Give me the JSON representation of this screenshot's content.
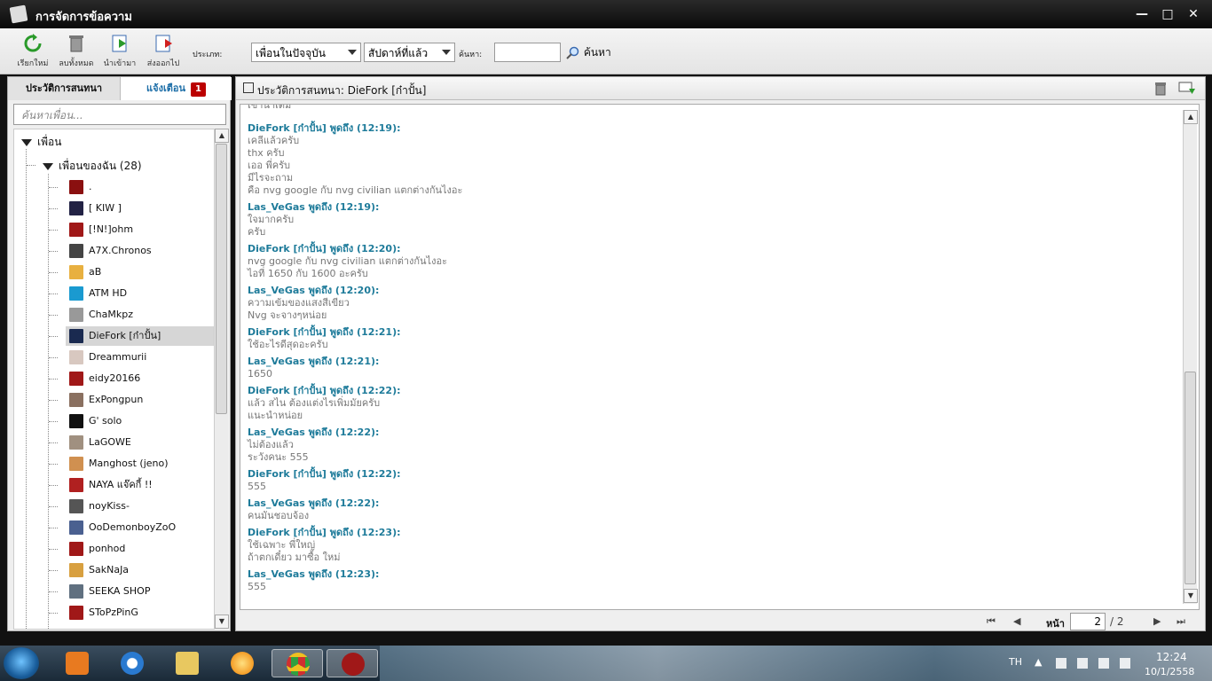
{
  "window": {
    "title": "การจัดการข้อความ",
    "controls": {
      "minimize": "—",
      "maximize": "□",
      "close": "✕"
    }
  },
  "toolbar": {
    "buttons": [
      {
        "label": "เรียกใหม่",
        "icon": "refresh-icon"
      },
      {
        "label": "ลบทั้งหมด",
        "icon": "trash-icon"
      },
      {
        "label": "นำเข้ามา",
        "icon": "import-icon"
      },
      {
        "label": "ส่งออกไป",
        "icon": "export-icon"
      }
    ],
    "type_label": "ประเภท:",
    "type_value": "เพื่อนในปัจจุบัน",
    "period_value": "สัปดาห์ที่แล้ว",
    "search_label": "ค้นหา:",
    "search_value": "",
    "search_button": "ค้นหา"
  },
  "left_panel": {
    "tab_history": "ประวัติการสนทนา",
    "tab_notify": "แจ้งเตือน",
    "notify_count": "1",
    "friend_search_placeholder": "ค้นหาเพื่อน...",
    "root": "เพื่อน",
    "group": "เพื่อนของฉัน (28)",
    "friends": [
      {
        "name": ".",
        "color": "#8a1010"
      },
      {
        "name": "[ KIW ]",
        "color": "#222244"
      },
      {
        "name": "[!N!]ohm",
        "color": "#a01818"
      },
      {
        "name": "A7X.Chronos",
        "color": "#444"
      },
      {
        "name": "aB",
        "color": "#e8b040"
      },
      {
        "name": "ATM HD",
        "color": "#1a9ad0"
      },
      {
        "name": "ChaMkpz",
        "color": "#999"
      },
      {
        "name": "DieFork [ก๋าปั้น]",
        "color": "#1a2a50"
      },
      {
        "name": "Dreammurii",
        "color": "#d8c8c0"
      },
      {
        "name": "eidy20166",
        "color": "#a01818"
      },
      {
        "name": "ExPongpun",
        "color": "#8a7060"
      },
      {
        "name": "G' solo",
        "color": "#111"
      },
      {
        "name": "LaGOWE",
        "color": "#a09080"
      },
      {
        "name": "Manghost (jeno)",
        "color": "#d09050"
      },
      {
        "name": "NAYA แจ๊คกี้ !!",
        "color": "#b02020"
      },
      {
        "name": "noyKiss-",
        "color": "#555"
      },
      {
        "name": "OoDemonboyZoO",
        "color": "#4a6090"
      },
      {
        "name": "ponhod",
        "color": "#a01818"
      },
      {
        "name": "SakNaJa",
        "color": "#d8a040"
      },
      {
        "name": "SEEKA SHOP",
        "color": "#607080"
      },
      {
        "name": "SToPzPinG",
        "color": "#a01818"
      }
    ]
  },
  "conversation": {
    "header": "ประวัติการสนทนา: DieFork [ก๋าปั้น]",
    "partial_top": "เข้าน่าเดิม",
    "messages": [
      {
        "head": "DieFork [ก๋าปั้น] พูดถึง  (12:19):",
        "lines": [
          "เคลีแล้วครับ",
          "thx ครับ",
          "เออ พี่ครับ",
          "มีไรจะถาม",
          "คือ nvg google กับ nvg civilian แตกต่างกันไงอะ"
        ]
      },
      {
        "head": "Las_VeGas พูดถึง  (12:19):",
        "lines": [
          "ใจมากครับ",
          "ครับ"
        ]
      },
      {
        "head": "DieFork [ก๋าปั้น] พูดถึง  (12:20):",
        "lines": [
          "nvg google กับ nvg civilian แตกต่างกันไงอะ",
          "ไอที่ 1650 กับ 1600 อะครับ"
        ]
      },
      {
        "head": "Las_VeGas พูดถึง  (12:20):",
        "lines": [
          "ความเข้มของแสงสีเขียว",
          "Nvg จะจางๆหน่อย"
        ]
      },
      {
        "head": "DieFork [ก๋าปั้น] พูดถึง  (12:21):",
        "lines": [
          "ใช้อะไรดีสุดอะครับ"
        ]
      },
      {
        "head": "Las_VeGas พูดถึง  (12:21):",
        "lines": [
          "1650"
        ]
      },
      {
        "head": "DieFork [ก๋าปั้น] พูดถึง  (12:22):",
        "lines": [
          "แล้ว สไน ต้องแต่งไรเพิ่มมัยครับ",
          "แนะนำหน่อย"
        ]
      },
      {
        "head": "Las_VeGas พูดถึง  (12:22):",
        "lines": [
          "ไม่ต้องแล้ว",
          "ระวังคนะ 555"
        ]
      },
      {
        "head": "DieFork [ก๋าปั้น] พูดถึง  (12:22):",
        "lines": [
          "555"
        ]
      },
      {
        "head": "Las_VeGas พูดถึง  (12:22):",
        "lines": [
          "คนมันชอบจ้อง"
        ]
      },
      {
        "head": "DieFork [ก๋าปั้น] พูดถึง  (12:23):",
        "lines": [
          "ใช้เฉพาะ พี่ใหญ่",
          "ถ้าตกเดี๋ยว มาซื้อ ใหม่"
        ]
      },
      {
        "head": "Las_VeGas พูดถึง  (12:23):",
        "lines": [
          "555"
        ]
      }
    ]
  },
  "pager": {
    "label": "หน้า",
    "current": "2",
    "total": "/ 2",
    "first": "⏮",
    "prev": "◀",
    "next": "▶",
    "last": "⏭"
  },
  "taskbar": {
    "lang": "TH",
    "time": "12:24",
    "date": "10/1/2558"
  }
}
